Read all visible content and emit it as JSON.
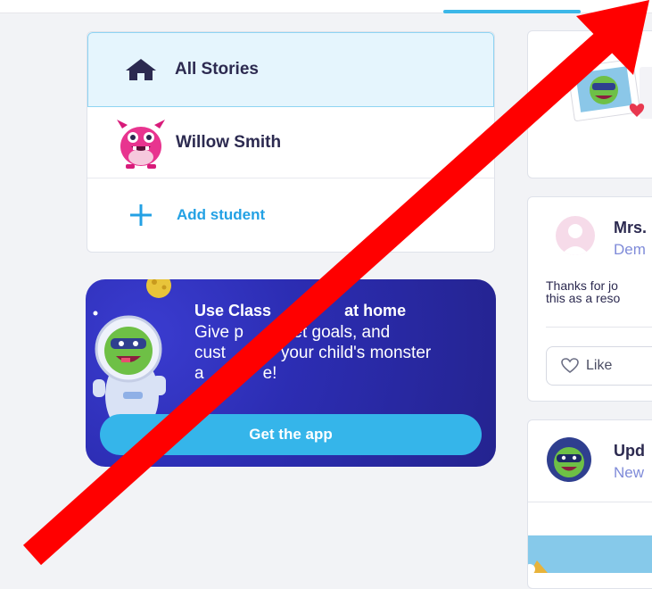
{
  "sidebar": {
    "all_stories_label": "All Stories",
    "student_name": "Willow Smith",
    "add_student_label": "Add student"
  },
  "promo": {
    "title": "Use Class",
    "title_tail": "at home",
    "body_1": "Give p",
    "body_1_tail": "set goals, and",
    "body_2": "cust",
    "body_2_tail": "your child's monster",
    "body_3": "a",
    "body_3_tail": "e!",
    "button_label": "Get the app"
  },
  "feed": {
    "post_author": "Mrs.",
    "post_subtitle": "Dem",
    "post_line_1": "Thanks for jo",
    "post_line_2": "this as a reso",
    "like_label": "Like",
    "update_title": "Upd",
    "update_subtitle": "New"
  },
  "colors": {
    "accent": "#23a1e4",
    "promo_bg": "#2c2db3",
    "annotation_arrow": "#ff0000"
  }
}
